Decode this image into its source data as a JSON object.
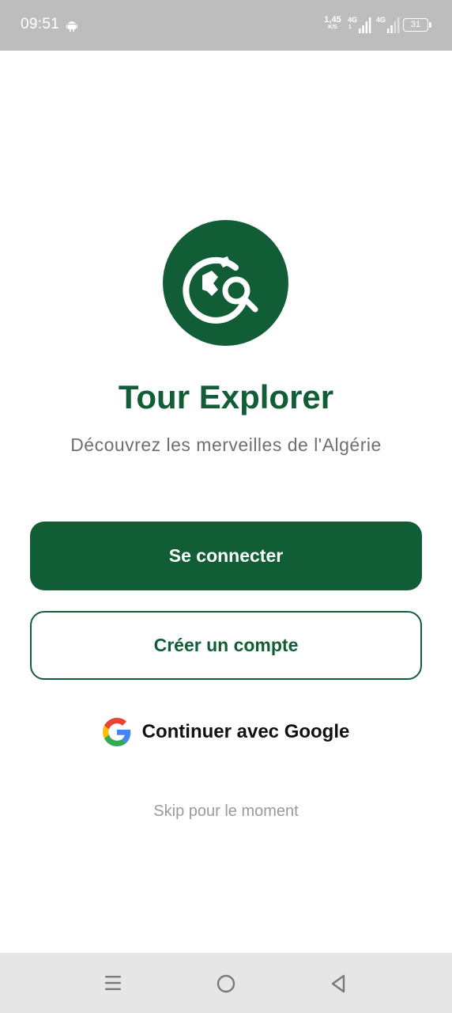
{
  "status_bar": {
    "time": "09:51",
    "network_speed_value": "1,45",
    "network_speed_unit": "K/S",
    "sim1_type": "4G",
    "sim1_sub": "1",
    "sim2_type": "4G",
    "battery_level": "31",
    "icons": [
      "android-icon",
      "signal-icon",
      "signal-icon",
      "battery-icon"
    ]
  },
  "branding": {
    "logo_icon": "travel-explore-icon",
    "title": "Tour Explorer",
    "subtitle": "Découvrez les merveilles de l'Algérie"
  },
  "actions": {
    "login_label": "Se connecter",
    "register_label": "Créer un compte",
    "google_label": "Continuer avec Google",
    "skip_label": "Skip pour le moment"
  },
  "nav_bar": {
    "icons": [
      "menu-icon",
      "home-icon",
      "back-icon"
    ]
  },
  "colors": {
    "primary": "#115e36",
    "status_bar": "#bdbdbd",
    "nav_bar": "#e6e6e6",
    "subtitle_text": "#6f6f6f",
    "skip_text": "#9a9a9a"
  }
}
